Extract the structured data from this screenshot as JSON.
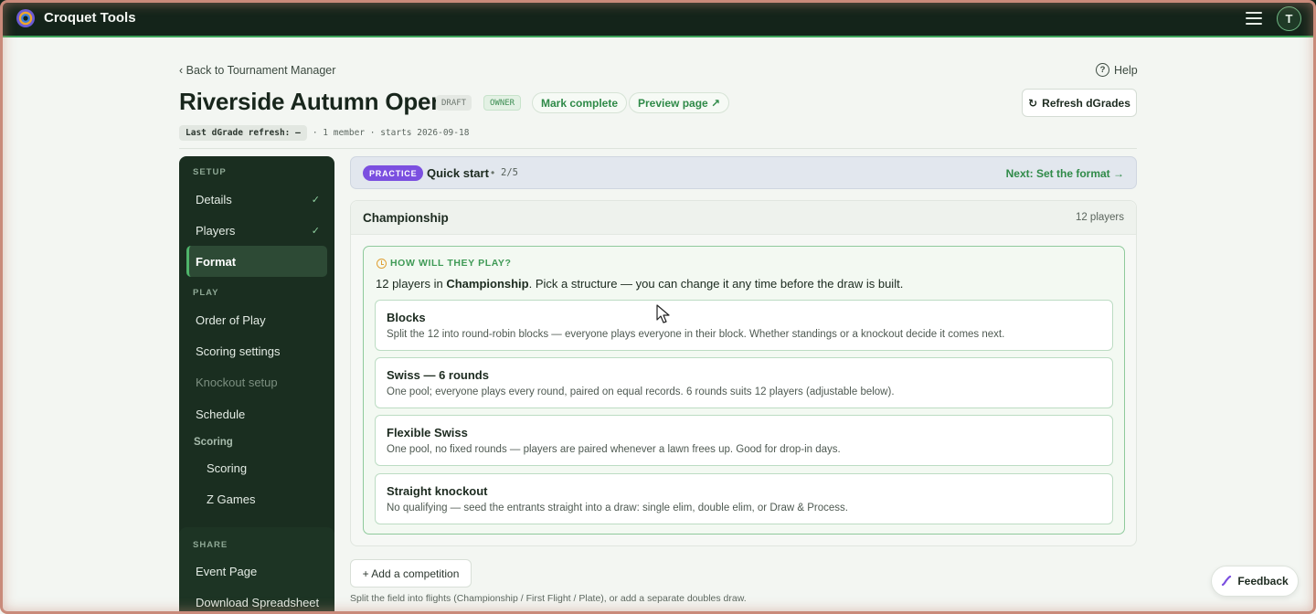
{
  "app": {
    "title": "Croquet Tools",
    "avatar_initial": "T"
  },
  "header": {
    "back_label": "‹ Back to Tournament Manager",
    "help_label": "Help",
    "help_glyph": "?",
    "title": "Riverside Autumn Open",
    "badges": {
      "draft": "DRAFT",
      "owner": "OWNER"
    },
    "mark_complete": "Mark complete",
    "preview_page": "Preview page ↗",
    "refresh_button": "Refresh dGrades",
    "refresh_glyph": "↻",
    "meta_chip": "Last dGrade refresh: —",
    "meta_rest": "· 1 member · starts 2026-09-18"
  },
  "sidebar": {
    "setup_heading": "SETUP",
    "setup_items": [
      {
        "label": "Details",
        "check": "✓"
      },
      {
        "label": "Players",
        "check": "✓"
      },
      {
        "label": "Format"
      }
    ],
    "play_heading": "PLAY",
    "play_items": [
      {
        "label": "Order of Play"
      },
      {
        "label": "Scoring settings"
      },
      {
        "label": "Knockout setup"
      },
      {
        "label": "Schedule"
      }
    ],
    "scoring_group": "Scoring",
    "scoring_items": [
      {
        "label": "Scoring"
      },
      {
        "label": "Z Games"
      }
    ],
    "share_heading": "SHARE",
    "share_items": [
      {
        "label": "Event Page"
      },
      {
        "label": "Download Spreadsheet"
      }
    ]
  },
  "practice": {
    "tag": "PRACTICE",
    "title": "Quick start",
    "separator": "•",
    "step": "2/5",
    "next_label": "Next: Set the format →"
  },
  "competition": {
    "name": "Championship",
    "player_count": "12 players",
    "question": "HOW WILL THEY PLAY?",
    "intro_prefix": "12 players in ",
    "intro_name": "Championship",
    "intro_suffix": ". Pick a structure — you can change it any time before the draw is built.",
    "options": [
      {
        "title": "Blocks",
        "desc": "Split the 12 into round-robin blocks — everyone plays everyone in their block. Whether standings or a knockout decide it comes next."
      },
      {
        "title": "Swiss — 6 rounds",
        "desc": "One pool; everyone plays every round, paired on equal records. 6 rounds suits 12 players (adjustable below)."
      },
      {
        "title": "Flexible Swiss",
        "desc": "One pool, no fixed rounds — players are paired whenever a lawn frees up. Good for drop-in days."
      },
      {
        "title": "Straight knockout",
        "desc": "No qualifying — seed the entrants straight into a draw: single elim, double elim, or Draw & Process."
      }
    ]
  },
  "footer": {
    "add_competition": "+ Add a competition",
    "hint": "Split the field into flights (Championship / First Flight / Plate), or add a separate doubles draw.",
    "feedback": "Feedback"
  },
  "colors": {
    "accent": "#2f8a48",
    "sidebar": "#1a2e20",
    "topbar": "#14241a",
    "practice_tag": "#7b4fe0"
  }
}
